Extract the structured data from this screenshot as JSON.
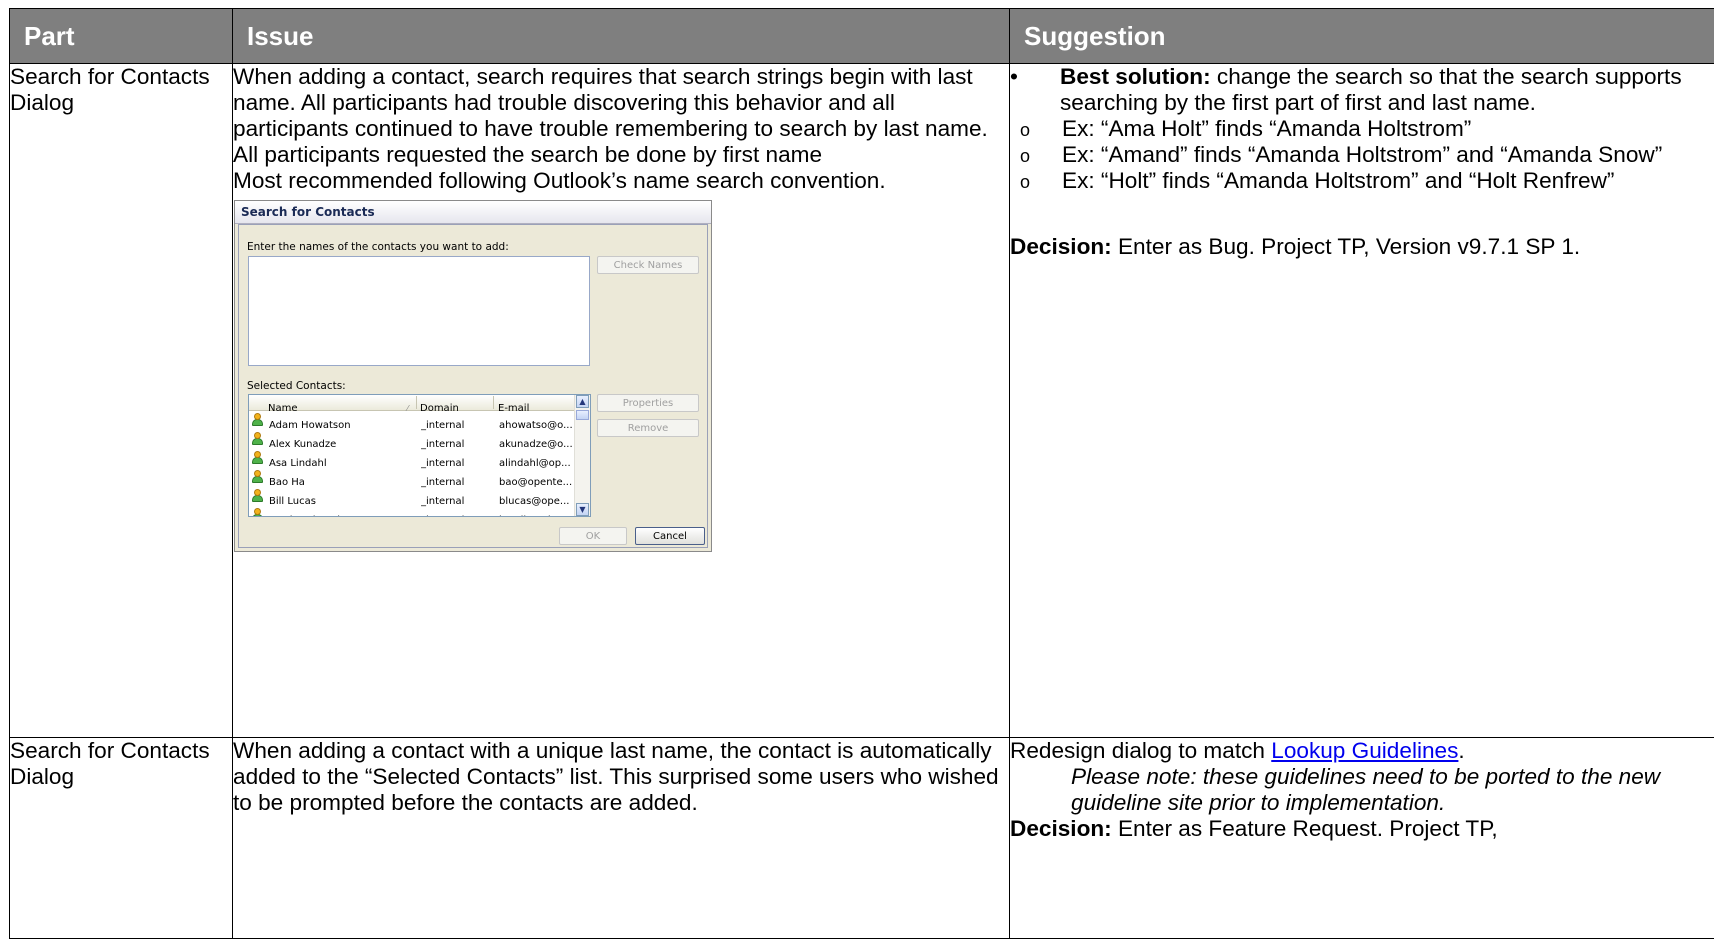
{
  "headers": {
    "part": "Part",
    "issue": "Issue",
    "suggestion": "Suggestion"
  },
  "rows": [
    {
      "part": "Search for Contacts Dialog",
      "issue": [
        "When adding a contact, search requires that search strings begin with last name. All participants had trouble discovering this behavior and all participants continued to have trouble remembering to search by last name.",
        "All participants requested the search be done by first name",
        "Most recommended following Outlook’s name search convention."
      ],
      "suggestion": {
        "bullet": "•",
        "best_label": "Best solution:",
        "best_text": " change the search so that the search supports searching by the first part of first and last name.",
        "sub_bullet": "o",
        "examples": [
          "Ex: “Ama Holt” finds “Amanda Holtstrom”",
          "Ex: “Amand” finds “Amanda Holtstrom” and “Amanda Snow”",
          "Ex: “Holt” finds “Amanda Holtstrom” and “Holt Renfrew”"
        ],
        "decision_label": "Decision:",
        "decision_text": " Enter as Bug. Project TP, Version v9.7.1 SP 1."
      }
    },
    {
      "part": "Search for Contacts Dialog",
      "issue": [
        "When adding a contact with a unique last name, the contact is automatically added to the “Selected Contacts” list. This surprised some users who wished to be prompted before the contacts are added."
      ],
      "suggestion": {
        "redesign_text": "Redesign dialog to match ",
        "link_text": "Lookup Guidelines",
        "redesign_end": ".",
        "note": "Please note: these guidelines need to be ported to the new guideline site prior to implementation.",
        "decision_label": "Decision:",
        "decision_text": " Enter as Feature Request. Project TP,"
      }
    }
  ],
  "dialog": {
    "title": "Search for Contacts",
    "prompt": "Enter the names of the contacts you want to add:",
    "check_names": "Check Names",
    "selected_label": "Selected Contacts:",
    "properties": "Properties",
    "remove": "Remove",
    "ok": "OK",
    "cancel": "Cancel",
    "columns": {
      "name": "Name",
      "domain": "Domain",
      "email": "E-mail"
    },
    "contacts": [
      {
        "name": "Adam Howatson",
        "domain": "_internal",
        "email": "ahowatso@o..."
      },
      {
        "name": "Alex Kunadze",
        "domain": "_internal",
        "email": "akunadze@o..."
      },
      {
        "name": "Asa Lindahl",
        "domain": "_internal",
        "email": "alindahl@op..."
      },
      {
        "name": "Bao Ha",
        "domain": "_internal",
        "email": "bao@opente..."
      },
      {
        "name": "Bill Lucas",
        "domain": "_internal",
        "email": "blucas@ope..."
      },
      {
        "name": "Brad McIlmoyl",
        "domain": "_internal",
        "email": "bmcilmoyl@..."
      }
    ]
  }
}
